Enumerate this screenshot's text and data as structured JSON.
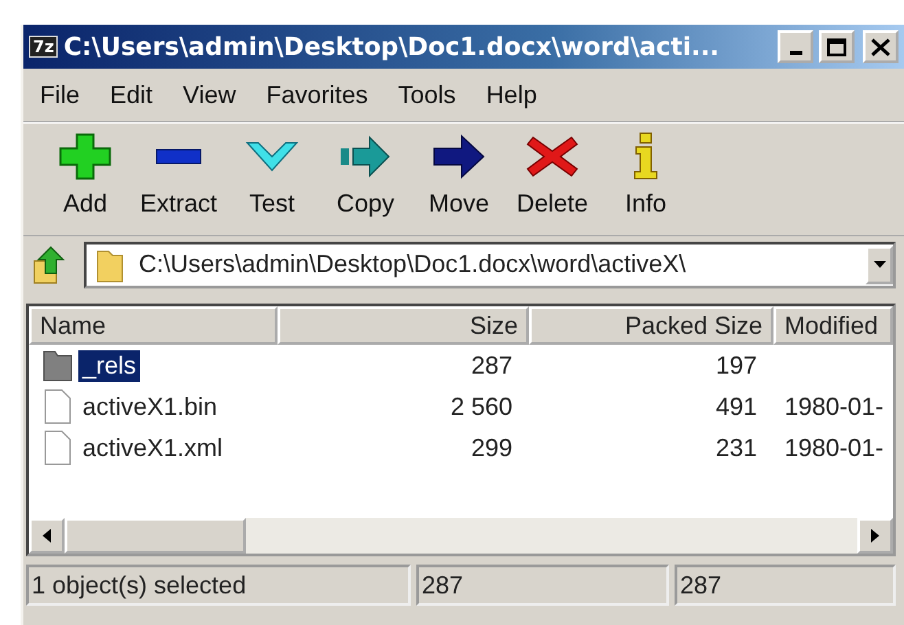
{
  "window": {
    "app_badge": "7z",
    "title": "C:\\Users\\admin\\Desktop\\Doc1.docx\\word\\acti..."
  },
  "menu": [
    "File",
    "Edit",
    "View",
    "Favorites",
    "Tools",
    "Help"
  ],
  "toolbar": [
    {
      "kind": "add",
      "label": "Add"
    },
    {
      "kind": "extract",
      "label": "Extract"
    },
    {
      "kind": "test",
      "label": "Test"
    },
    {
      "kind": "copy",
      "label": "Copy"
    },
    {
      "kind": "move",
      "label": "Move"
    },
    {
      "kind": "delete",
      "label": "Delete"
    },
    {
      "kind": "info",
      "label": "Info"
    }
  ],
  "address": {
    "value": "C:\\Users\\admin\\Desktop\\Doc1.docx\\word\\activeX\\"
  },
  "table": {
    "columns": [
      "Name",
      "Size",
      "Packed Size",
      "Modified"
    ],
    "rows": [
      {
        "kind": "folder",
        "name": "_rels",
        "size": "287",
        "packed": "197",
        "modified": "",
        "selected": true
      },
      {
        "kind": "file",
        "name": "activeX1.bin",
        "size": "2 560",
        "packed": "491",
        "modified": "1980-01-",
        "selected": false
      },
      {
        "kind": "file",
        "name": "activeX1.xml",
        "size": "299",
        "packed": "231",
        "modified": "1980-01-",
        "selected": false
      }
    ]
  },
  "status_bar": [
    "1 object(s) selected",
    "287",
    "287"
  ]
}
